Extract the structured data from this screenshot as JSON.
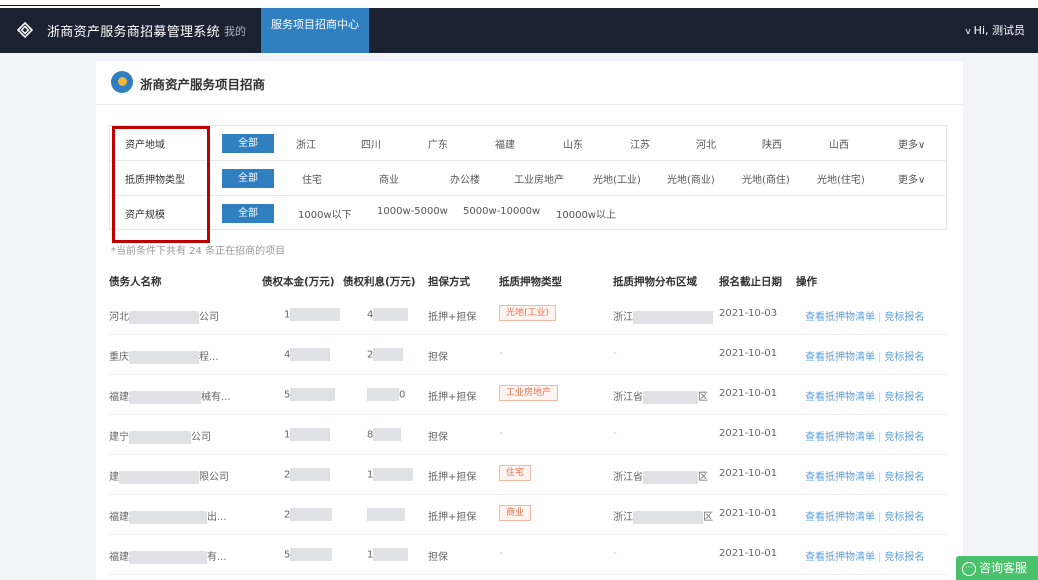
{
  "topbar": {
    "app_title": "浙商资产服务商招募管理系统",
    "nav_mine": "我的",
    "nav_active": "服务项目招商中心",
    "user_greeting": "Hi, 测试员",
    "chevron": "v"
  },
  "card": {
    "title": "浙商资产服务项目招商"
  },
  "filters": {
    "region": {
      "label": "资产地域",
      "all": "全部",
      "options": [
        "浙江",
        "四川",
        "广东",
        "福建",
        "山东",
        "江苏",
        "河北",
        "陕西",
        "山西"
      ],
      "more": "更多∨"
    },
    "collateral_type": {
      "label": "抵质押物类型",
      "all": "全部",
      "options": [
        "住宅",
        "商业",
        "办公楼",
        "工业房地产",
        "光地(工业)",
        "光地(商业)",
        "光地(商住)",
        "光地(住宅)"
      ],
      "more": "更多∨"
    },
    "scale": {
      "label": "资产规模",
      "all": "全部",
      "options": [
        "1000w以下",
        "1000w-5000w",
        "5000w-10000w",
        "10000w以上"
      ]
    }
  },
  "count_text": "*当前条件下共有 24 条正在招商的项目",
  "table": {
    "headers": [
      "债务人名称",
      "债权本金(万元)",
      "债权利息(万元)",
      "担保方式",
      "抵质押物类型",
      "抵质押物分布区域",
      "报名截止日期",
      "操作"
    ],
    "rows": [
      {
        "debtor_a": "河北",
        "debtor_b": "公司",
        "principal": "1",
        "interest": "4",
        "guarantee": "抵押+担保",
        "type": "光地(工业)",
        "region_a": "浙江",
        "region_b": "",
        "deadline": "2021-10-03"
      },
      {
        "debtor_a": "重庆",
        "debtor_b": "程...",
        "principal": "4",
        "interest": "2",
        "guarantee": "担保",
        "type": "",
        "type_dash": "-",
        "region_a": "-",
        "region_b": "",
        "deadline": "2021-10-01"
      },
      {
        "debtor_a": "福建",
        "debtor_b": "械有...",
        "principal": "5",
        "interest": "0",
        "guarantee": "抵押+担保",
        "type": "工业房地产",
        "region_a": "浙江省",
        "region_b": "区",
        "deadline": "2021-10-01"
      },
      {
        "debtor_a": "建宁",
        "debtor_b": "公司",
        "principal": "1",
        "interest": "8",
        "guarantee": "担保",
        "type": "",
        "type_dash": "-",
        "region_a": "-",
        "region_b": "",
        "deadline": "2021-10-01"
      },
      {
        "debtor_a": "建",
        "debtor_b": "限公司",
        "principal": "2",
        "interest": "1",
        "guarantee": "抵押+担保",
        "type": "住宅",
        "region_a": "浙江省",
        "region_b": "区",
        "deadline": "2021-10-01"
      },
      {
        "debtor_a": "福建",
        "debtor_b": "出...",
        "principal": "2",
        "interest": "",
        "guarantee": "抵押+担保",
        "type": "商业",
        "region_a": "浙江",
        "region_b": "区",
        "deadline": "2021-10-01"
      },
      {
        "debtor_a": "福建",
        "debtor_b": "有...",
        "principal": "5",
        "interest": "1",
        "guarantee": "担保",
        "type": "",
        "type_dash": "-",
        "region_a": "-",
        "region_b": "",
        "deadline": "2021-10-01"
      }
    ],
    "action_view": "查看抵押物清单",
    "action_sep": "|",
    "action_bid": "竞标报名"
  },
  "service_button": "咨询客服",
  "service_icon_text": "···",
  "colors": {
    "topbar_bg": "#1a2232",
    "primary": "#2f7fc1",
    "link": "#5fa0d8",
    "tag_text": "#e5734d",
    "highlight_box": "#c00000",
    "service_green": "#4cc16c"
  }
}
